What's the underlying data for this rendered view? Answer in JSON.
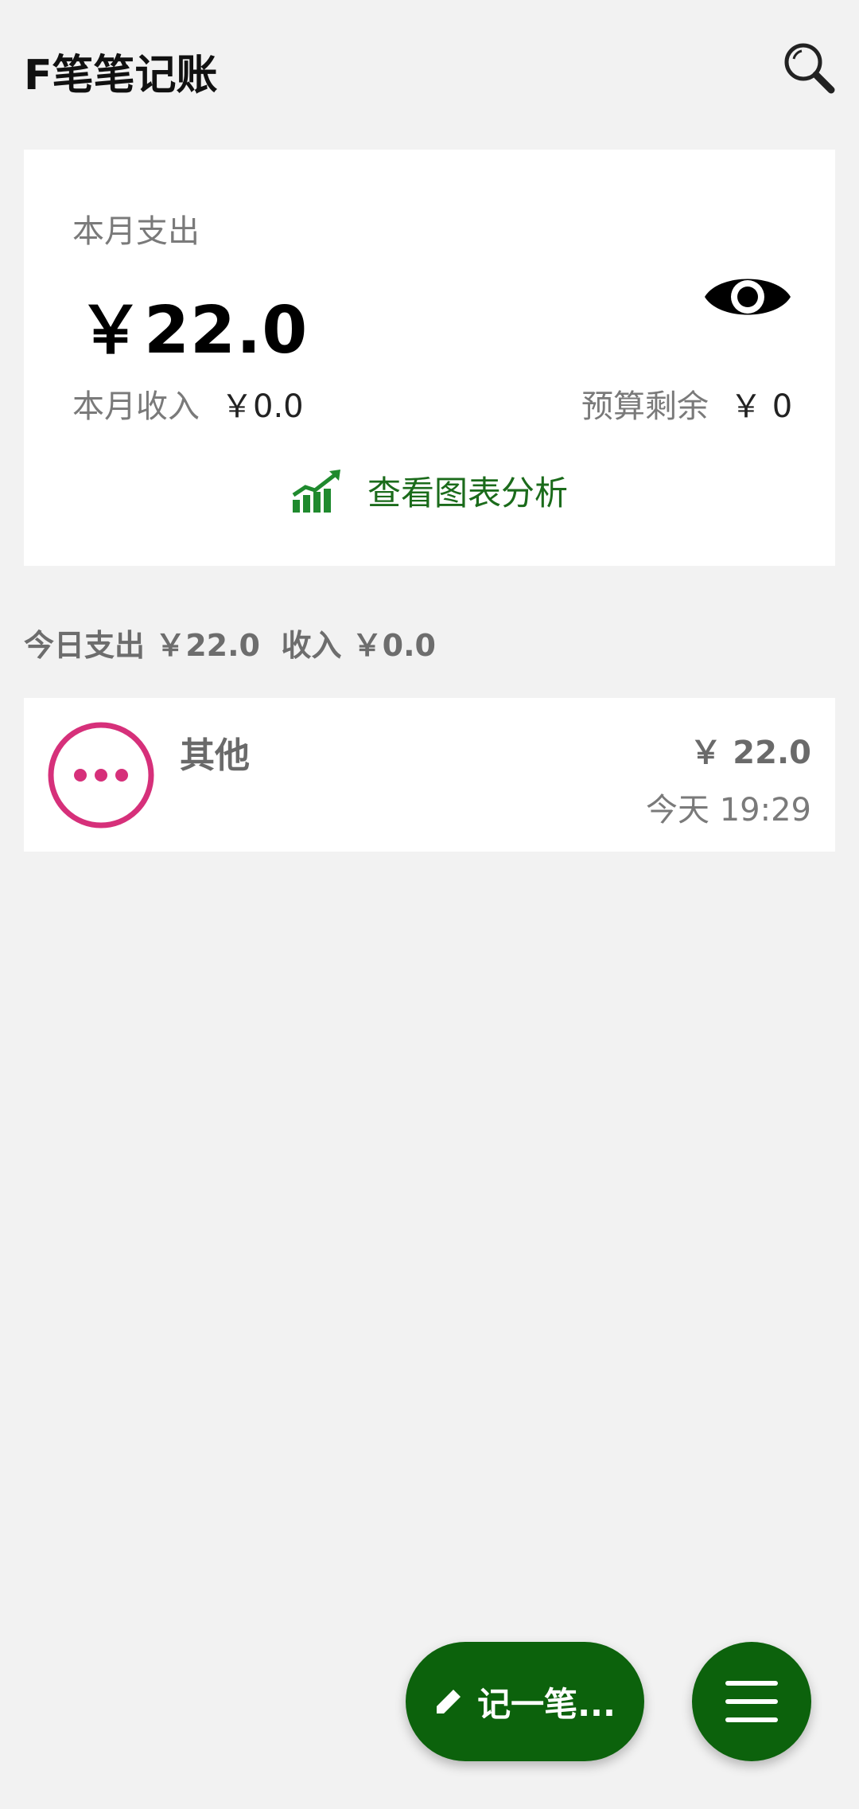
{
  "app": {
    "title": "F笔笔记账"
  },
  "summary": {
    "month_expense_label": "本月支出",
    "month_expense_amount": "￥22.0",
    "month_income_label": "本月收入",
    "month_income_amount": "￥0.0",
    "budget_remaining_label": "预算剩余",
    "budget_remaining_amount": "￥ 0",
    "chart_link_label": "查看图表分析"
  },
  "today": {
    "summary_text": "今日支出 ￥22.0  收入 ￥0.0"
  },
  "records": [
    {
      "category": "其他",
      "amount": "￥ 22.0",
      "time": "今天 19:29",
      "icon": "more-dots-icon"
    }
  ],
  "actions": {
    "record_label": "记一笔...",
    "menu_icon": "menu-icon"
  },
  "colors": {
    "brand_green": "#0c620c",
    "chart_green": "#1b6b1b",
    "category_pink": "#d6307a",
    "background": "#f2f2f2"
  }
}
